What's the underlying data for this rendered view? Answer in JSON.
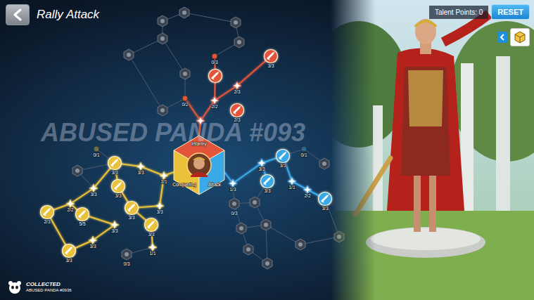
{
  "title": "Rally Attack",
  "talent_points": "Talent Points: 0",
  "reset_button": "RESET",
  "watermark": "ABUSED PANDA #093",
  "badge": {
    "title": "COLLECTED",
    "subtitle": "ABUSED PANDA #0936"
  },
  "branches": [
    {
      "name": "Infantry",
      "color": "#e2553b",
      "nodes": [
        {
          "count": "0/3",
          "kind": "dot",
          "unlocked": true
        },
        {
          "kind": "icon",
          "unlocked": true
        },
        {
          "count": "3/3",
          "kind": "icon",
          "unlocked": true
        },
        {
          "count": "2/3",
          "kind": "star",
          "unlocked": true
        },
        {
          "count": "2/2",
          "kind": "star",
          "unlocked": true
        },
        {
          "count": "2/3",
          "kind": "icon",
          "unlocked": true
        },
        {
          "count": "0/2",
          "kind": "dot",
          "unlocked": true
        },
        {
          "kind": "star",
          "unlocked": true
        },
        {
          "kind": "icon",
          "unlocked": false
        },
        {
          "kind": "icon",
          "unlocked": false
        },
        {
          "kind": "icon",
          "unlocked": false
        },
        {
          "kind": "icon",
          "unlocked": false
        },
        {
          "kind": "icon",
          "unlocked": false
        },
        {
          "kind": "icon",
          "unlocked": false
        },
        {
          "kind": "icon",
          "unlocked": false
        },
        {
          "kind": "icon",
          "unlocked": false
        }
      ]
    },
    {
      "name": "Conquering",
      "color": "#e9c13a",
      "nodes": [
        {
          "count": "1/1",
          "kind": "star",
          "unlocked": true
        },
        {
          "count": "3/3",
          "kind": "star",
          "unlocked": true
        },
        {
          "count": "3/3",
          "kind": "icon",
          "unlocked": true
        },
        {
          "count": "0/1",
          "kind": "dot",
          "unlocked": false
        },
        {
          "count": "3/3",
          "kind": "star",
          "unlocked": true
        },
        {
          "count": "3/3",
          "kind": "icon",
          "unlocked": true
        },
        {
          "count": "2/2",
          "kind": "star",
          "unlocked": true
        },
        {
          "count": "2/3",
          "kind": "icon",
          "unlocked": true
        },
        {
          "count": "5/5",
          "kind": "icon",
          "unlocked": true
        },
        {
          "count": "3/3",
          "kind": "icon",
          "unlocked": true
        },
        {
          "count": "3/3",
          "kind": "star",
          "unlocked": true
        },
        {
          "count": "3/3",
          "kind": "icon",
          "unlocked": true
        },
        {
          "count": "3/3",
          "kind": "star",
          "unlocked": true
        },
        {
          "count": "3/3",
          "kind": "star",
          "unlocked": true
        },
        {
          "count": "3/3",
          "kind": "icon",
          "unlocked": true
        },
        {
          "count": "1/1",
          "kind": "star",
          "unlocked": true
        },
        {
          "count": "0/3",
          "kind": "icon",
          "unlocked": false
        },
        {
          "kind": "icon",
          "unlocked": false
        }
      ]
    },
    {
      "name": "Attack",
      "color": "#3aa9e8",
      "nodes": [
        {
          "count": "1/3",
          "kind": "star",
          "unlocked": true
        },
        {
          "count": "3/3",
          "kind": "star",
          "unlocked": true
        },
        {
          "count": "3/3",
          "kind": "icon",
          "unlocked": true
        },
        {
          "count": "0/1",
          "kind": "dot",
          "unlocked": false
        },
        {
          "count": "3/3",
          "kind": "icon",
          "unlocked": true
        },
        {
          "count": "1/1",
          "kind": "star",
          "unlocked": true
        },
        {
          "count": "2/2",
          "kind": "star",
          "unlocked": true
        },
        {
          "count": "3/3",
          "kind": "icon",
          "unlocked": true
        },
        {
          "kind": "icon",
          "unlocked": false
        },
        {
          "count": "0/3",
          "kind": "icon",
          "unlocked": false
        },
        {
          "kind": "icon",
          "unlocked": false
        },
        {
          "kind": "icon",
          "unlocked": false
        },
        {
          "kind": "icon",
          "unlocked": false
        },
        {
          "kind": "icon",
          "unlocked": false
        },
        {
          "kind": "icon",
          "unlocked": false
        },
        {
          "kind": "icon",
          "unlocked": false
        },
        {
          "kind": "icon",
          "unlocked": false
        }
      ]
    }
  ]
}
